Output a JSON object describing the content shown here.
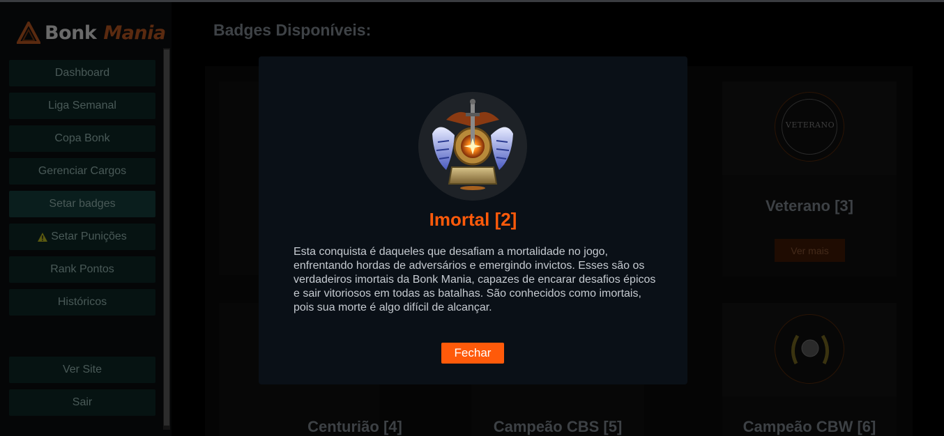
{
  "sidebar": {
    "logo": {
      "word1": "Bonk",
      "word2": "Mania"
    },
    "items": [
      {
        "label": "Dashboard"
      },
      {
        "label": "Liga Semanal"
      },
      {
        "label": "Copa Bonk"
      },
      {
        "label": "Gerenciar Cargos"
      },
      {
        "label": "Setar badges"
      },
      {
        "label": "Setar Punições",
        "icon": "warning-icon"
      },
      {
        "label": "Rank Pontos"
      },
      {
        "label": "Históricos"
      }
    ],
    "bottom_items": [
      {
        "label": "Ver Site"
      },
      {
        "label": "Sair"
      }
    ]
  },
  "main": {
    "title": "Badges Disponíveis:",
    "cards": [
      {
        "title": "Veterano [3]",
        "button": "Ver mais",
        "emblem_text": "VETERANO",
        "icon": "veterano-badge-icon"
      },
      {
        "title": "Centurião [4]"
      },
      {
        "title": "Campeão CBS [5]"
      },
      {
        "title": "Campeão CBW [6]",
        "icon": "cbw-badge-icon"
      }
    ]
  },
  "modal": {
    "title": "Imortal [2]",
    "description": "Esta conquista é daqueles que desafiam a mortalidade no jogo, enfrentando hordas de adversários e emergindo invictos. Esses são os verdadeiros imortais da Bonk Mania, capazes de encarar desafios épicos e sair vitoriosos em todas as batalhas. São conhecidos como imortais, pois sua morte é algo difícil de alcançar.",
    "close_label": "Fechar",
    "badge_icon": "imortal-badge-icon"
  },
  "colors": {
    "accent": "#ff5a0a",
    "modal_bg": "#0a1017",
    "text": "#c6cbd1"
  }
}
